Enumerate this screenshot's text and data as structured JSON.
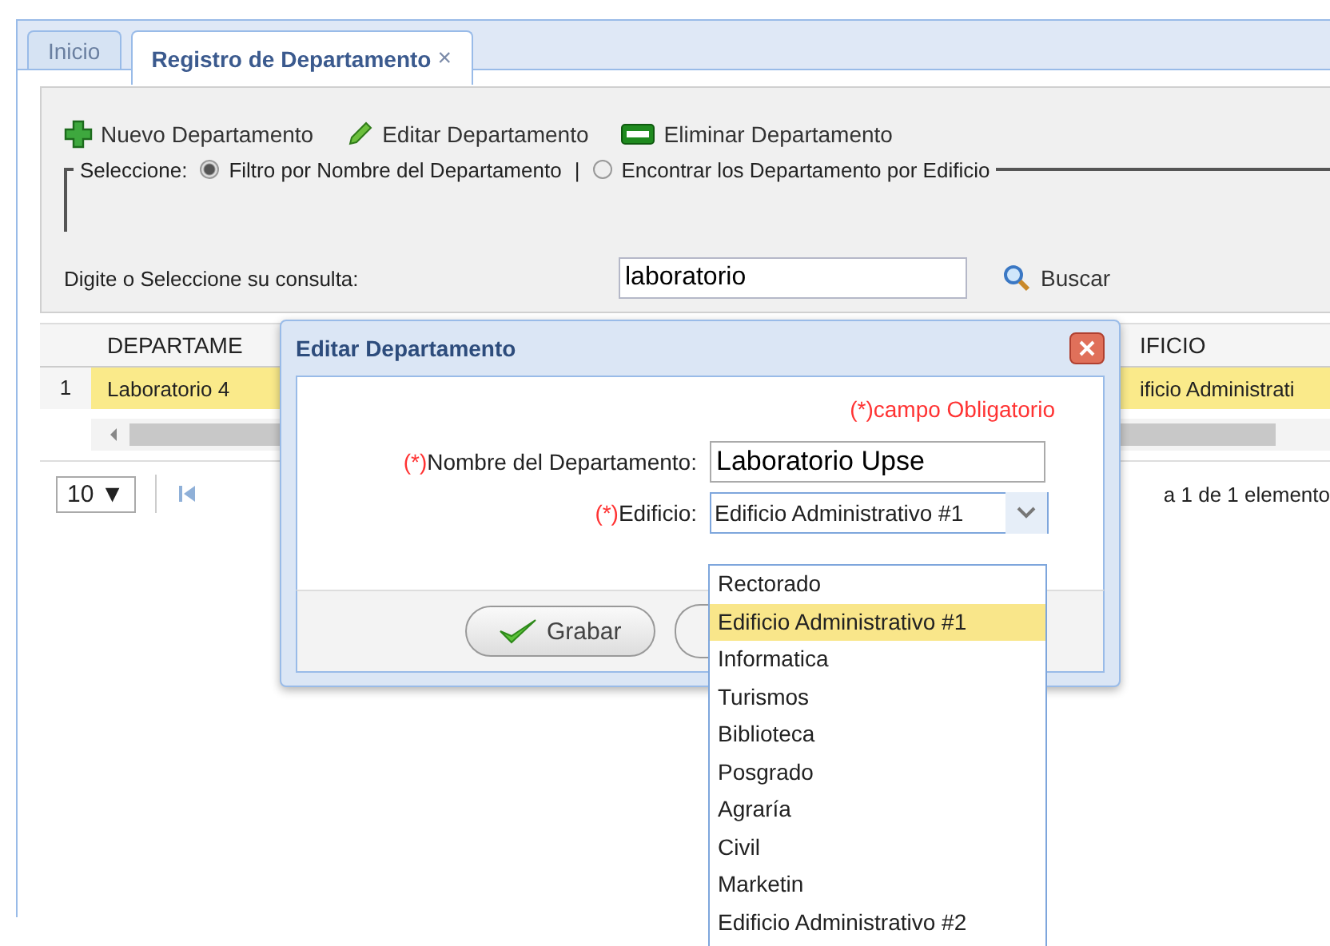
{
  "tabs": [
    {
      "label": "Inicio",
      "selected": false
    },
    {
      "label": "Registro de Departamento",
      "selected": true,
      "close": "×"
    }
  ],
  "toolbar": [
    {
      "label": "Nuevo Departamento",
      "kind": "add"
    },
    {
      "label": "Editar Departamento",
      "kind": "edit"
    },
    {
      "label": "Eliminar Departamento",
      "kind": "delete"
    }
  ],
  "filter": {
    "legend": "Seleccione:",
    "separator": "|",
    "options": [
      {
        "label": "Filtro por Nombre del Departamento",
        "selected": true
      },
      {
        "label": "Encontrar los Departamento por Edificio",
        "selected": false
      }
    ]
  },
  "query": {
    "label": "Digite o Seleccione su consulta:",
    "value": "laboratorio",
    "button": "Buscar"
  },
  "table": {
    "columns": [
      "DEPARTAME",
      "IFICIO"
    ],
    "rows": [
      {
        "number": "1",
        "cells": [
          "Laboratorio 4",
          "ificio Administrati"
        ],
        "selected": true
      }
    ]
  },
  "pager": {
    "page_size": "10 ▼",
    "summary": "a 1 de 1 elemento"
  },
  "dialog": {
    "title": "Editar Departamento",
    "required_note": "(*)campo Obligatorio",
    "fields": [
      {
        "marker": "(*)",
        "label": "Nombre del Departamento:",
        "kind": "text",
        "value": "Laboratorio Upse"
      },
      {
        "marker": "(*)",
        "label": "Edificio:",
        "kind": "select",
        "value": "Edificio Administrativo #1",
        "expanded": true
      }
    ],
    "button": "Grabar"
  },
  "dropdown": [
    {
      "label": "Rectorado",
      "selected": false
    },
    {
      "label": "Edificio Administrativo #1",
      "selected": true
    },
    {
      "label": "Informatica",
      "selected": false
    },
    {
      "label": "Turismos",
      "selected": false
    },
    {
      "label": "Biblioteca",
      "selected": false
    },
    {
      "label": "Posgrado",
      "selected": false
    },
    {
      "label": "Agraría",
      "selected": false
    },
    {
      "label": "Civil",
      "selected": false
    },
    {
      "label": "Marketin",
      "selected": false
    },
    {
      "label": "Edificio Administrativo #2",
      "selected": false
    }
  ]
}
